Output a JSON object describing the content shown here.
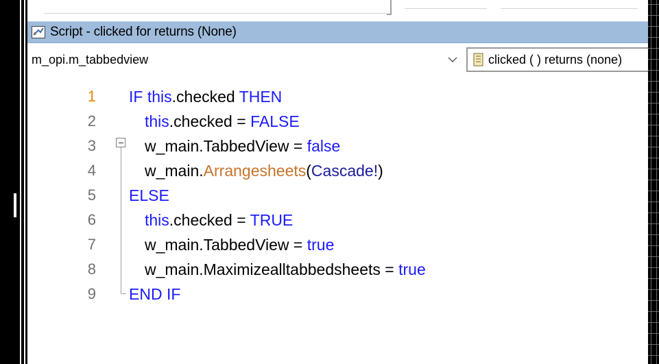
{
  "window": {
    "title": "Script - clicked for  returns (None)"
  },
  "selectors": {
    "object": "m_opi.m_tabbedview",
    "event": "clicked ( ) returns (none)"
  },
  "editor": {
    "active_line": 1,
    "lines": [
      {
        "number": "1",
        "segments": [
          {
            "t": "IF ",
            "c": "kw"
          },
          {
            "t": "this",
            "c": "kw"
          },
          {
            "t": ".checked ",
            "c": "plain"
          },
          {
            "t": "THEN",
            "c": "kw"
          }
        ]
      },
      {
        "number": "2",
        "segments": [
          {
            "t": "this",
            "c": "kw"
          },
          {
            "t": ".checked = ",
            "c": "plain"
          },
          {
            "t": "FALSE",
            "c": "kw"
          }
        ]
      },
      {
        "number": "3",
        "segments": [
          {
            "t": "w_main.TabbedView = ",
            "c": "plain"
          },
          {
            "t": "false",
            "c": "kw"
          }
        ]
      },
      {
        "number": "4",
        "segments": [
          {
            "t": "w_main.",
            "c": "plain"
          },
          {
            "t": "Arrangesheets",
            "c": "fn"
          },
          {
            "t": "(",
            "c": "plain"
          },
          {
            "t": "Cascade!",
            "c": "cn"
          },
          {
            "t": ")",
            "c": "plain"
          }
        ]
      },
      {
        "number": "5",
        "segments": [
          {
            "t": "ELSE",
            "c": "kw"
          }
        ]
      },
      {
        "number": "6",
        "segments": [
          {
            "t": "this",
            "c": "kw"
          },
          {
            "t": ".checked = ",
            "c": "plain"
          },
          {
            "t": "TRUE",
            "c": "kw"
          }
        ]
      },
      {
        "number": "7",
        "segments": [
          {
            "t": "w_main.TabbedView = ",
            "c": "plain"
          },
          {
            "t": "true",
            "c": "kw"
          }
        ]
      },
      {
        "number": "8",
        "segments": [
          {
            "t": "w_main.Maximizealltabbedsheets = ",
            "c": "plain"
          },
          {
            "t": "true",
            "c": "kw"
          }
        ]
      },
      {
        "number": "9",
        "segments": [
          {
            "t": "END ",
            "c": "kw"
          },
          {
            "t": "IF",
            "c": "kw"
          }
        ]
      }
    ]
  },
  "icons": {
    "title": "script-icon",
    "object_dropdown": "chevron-down-icon",
    "event": "event-script-icon",
    "fold": "fold-collapse-icon"
  },
  "colors": {
    "keyword": "#1a1aff",
    "function": "#c8742b",
    "constant": "#1a1a9a",
    "line_number": "#707070",
    "active_line_number": "#e08a00",
    "titlebar": "#9fbcdc"
  }
}
